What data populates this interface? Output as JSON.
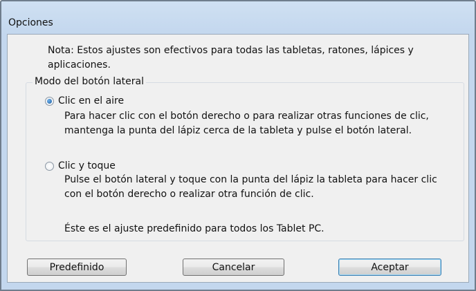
{
  "window": {
    "title": "Opciones"
  },
  "note": "Nota: Estos ajustes son efectivos para todas las tabletas, ratones, lápices y aplicaciones.",
  "group": {
    "legend": "Modo del botón lateral",
    "options": [
      {
        "label": "Clic en el aire",
        "checked": true,
        "description": "Para hacer clic con el botón derecho o para realizar otras funciones de clic, mantenga la punta del lápiz cerca de la tableta y pulse el botón lateral."
      },
      {
        "label": "Clic y toque",
        "checked": false,
        "description": "Pulse el botón lateral y toque con la punta del lápiz la tableta para hacer clic con el botón derecho o realizar otra función de clic.",
        "note": "Éste es el ajuste predefinido para todos los Tablet PC."
      }
    ]
  },
  "buttons": {
    "default_label": "Predefinido",
    "cancel_label": "Cancelar",
    "accept_label": "Aceptar"
  }
}
